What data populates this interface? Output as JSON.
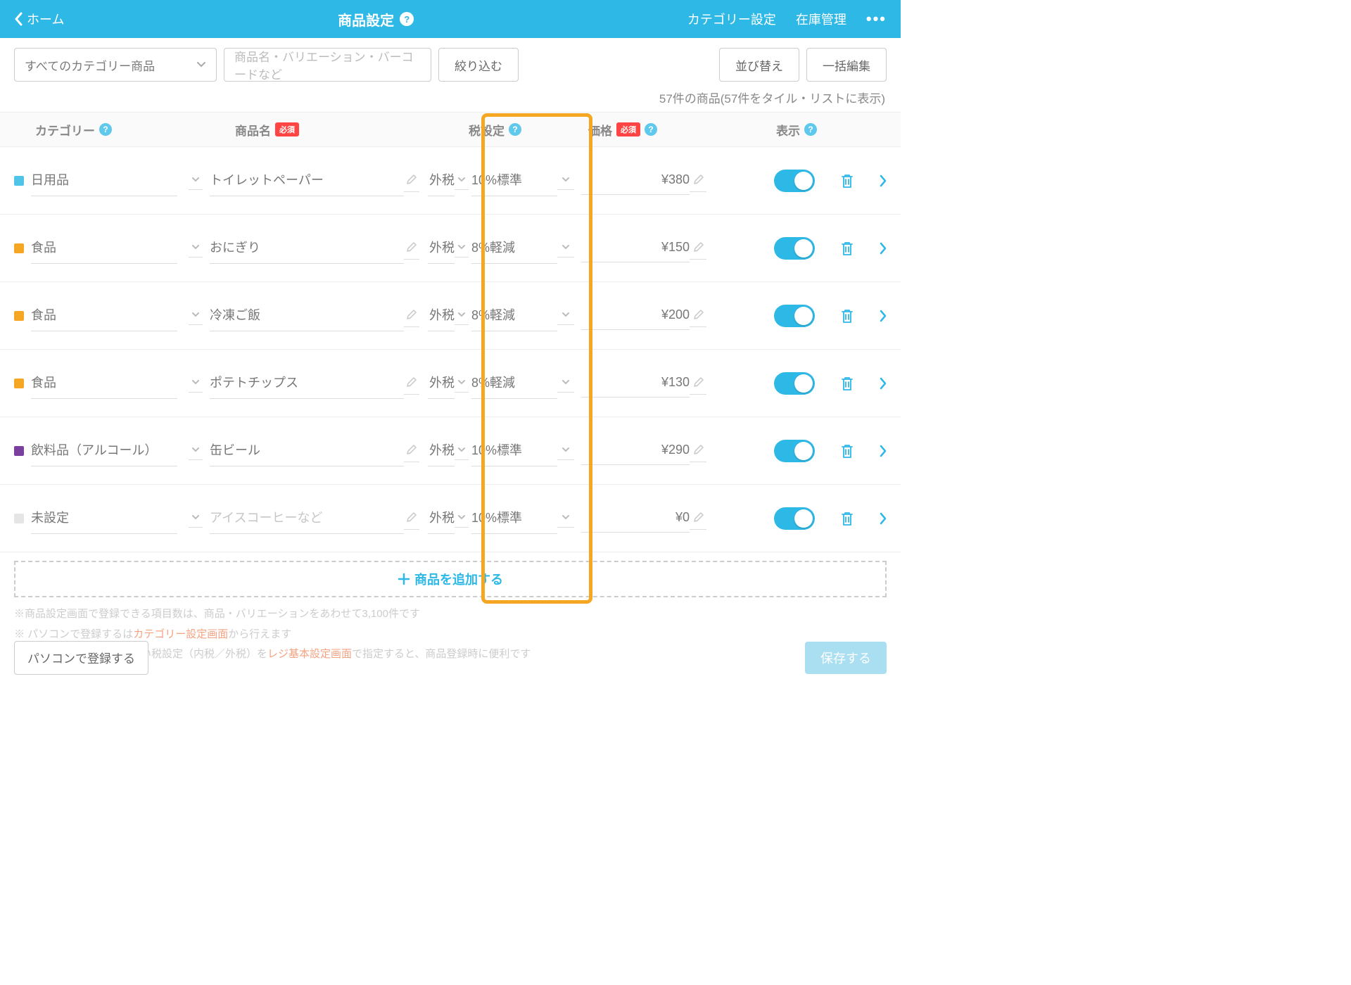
{
  "header": {
    "back": "ホーム",
    "title": "商品設定",
    "categorySettings": "カテゴリー設定",
    "inventory": "在庫管理"
  },
  "toolbar": {
    "categorySelect": "すべてのカテゴリー商品",
    "searchPlaceholder": "商品名・バリエーション・バーコードなど",
    "filter": "絞り込む",
    "sort": "並び替え",
    "bulkEdit": "一括編集"
  },
  "countLine": "57件の商品(57件をタイル・リストに表示)",
  "columns": {
    "category": "カテゴリー",
    "name": "商品名",
    "tax": "税設定",
    "price": "価格",
    "display": "表示",
    "required": "必須"
  },
  "rows": [
    {
      "swatch": "#4FC3E8",
      "category": "日用品",
      "name": "トイレットペーパー",
      "tax1": "外税",
      "tax2": "10%標準",
      "price": "¥380"
    },
    {
      "swatch": "#F5A623",
      "category": "食品",
      "name": "おにぎり",
      "tax1": "外税",
      "tax2": "8%軽減",
      "price": "¥150"
    },
    {
      "swatch": "#F5A623",
      "category": "食品",
      "name": "冷凍ご飯",
      "tax1": "外税",
      "tax2": "8%軽減",
      "price": "¥200"
    },
    {
      "swatch": "#F5A623",
      "category": "食品",
      "name": "ポテトチップス",
      "tax1": "外税",
      "tax2": "8%軽減",
      "price": "¥130"
    },
    {
      "swatch": "#7B3FA0",
      "category": "飲料品（アルコール）",
      "name": "缶ビール",
      "tax1": "外税",
      "tax2": "10%標準",
      "price": "¥290"
    },
    {
      "swatch": "#E5E5E5",
      "category": "未設定",
      "name": "アイスコーヒーなど",
      "placeholder": true,
      "tax1": "外税",
      "tax2": "10%標準",
      "price": "¥0"
    }
  ],
  "addRow": "商品を追加する",
  "info1a": "※商品設定画面で登録できる項目数は、商品・バリエーションをあわせて3,100件です",
  "info1b": "パソコンで登録する",
  "info2a": "カテゴリー設定画面",
  "info2b": "から行えます",
  "info3a": "※店舗で利用することが多い税設定（内税／外税）を",
  "info3b": "レジ基本設定画面",
  "info3c": "で指定すると、商品登録時に便利です",
  "pcButton": "パソコンで登録する",
  "saveButton": "保存する"
}
